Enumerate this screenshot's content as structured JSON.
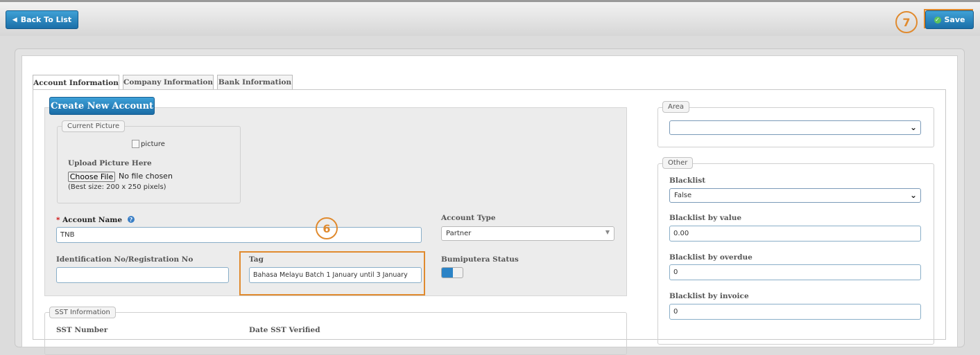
{
  "toolbar": {
    "back_label": "Back To List",
    "save_label": "Save",
    "save_marker": "7"
  },
  "tabs": [
    {
      "label": "Account Information"
    },
    {
      "label": "Company Information"
    },
    {
      "label": "Bank Information"
    }
  ],
  "create_label": "Create New Account",
  "picture": {
    "legend": "Current Picture",
    "alt_text": "picture",
    "upload_label": "Upload Picture Here",
    "choose_file": "Choose File",
    "no_file": "No file chosen",
    "hint": "(Best size: 200 x 250 pixels)"
  },
  "form": {
    "required_marker": "*",
    "account_name_label": "Account Name",
    "account_name_value": "TNB",
    "account_type_label": "Account Type",
    "account_type_value": "Partner",
    "id_label": "Identification No/Registration No",
    "id_value": "",
    "tag_label": "Tag",
    "tag_value": "Bahasa Melayu Batch 1 January until 3 January",
    "tag_marker": "6",
    "bumiputera_label": "Bumiputera Status",
    "bumiputera_on": true
  },
  "sst": {
    "legend": "SST Information",
    "number_label": "SST Number",
    "date_label": "Date SST Verified"
  },
  "area": {
    "legend": "Area",
    "value": ""
  },
  "other": {
    "legend": "Other",
    "blacklist_label": "Blacklist",
    "blacklist_value": "False",
    "by_value_label": "Blacklist by value",
    "by_value_value": "0.00",
    "by_overdue_label": "Blacklist by overdue",
    "by_overdue_value": "0",
    "by_invoice_label": "Blacklist by invoice",
    "by_invoice_value": "0"
  },
  "colors": {
    "accent_blue": "#1b6fa8",
    "highlight_orange": "#e08a2e"
  }
}
